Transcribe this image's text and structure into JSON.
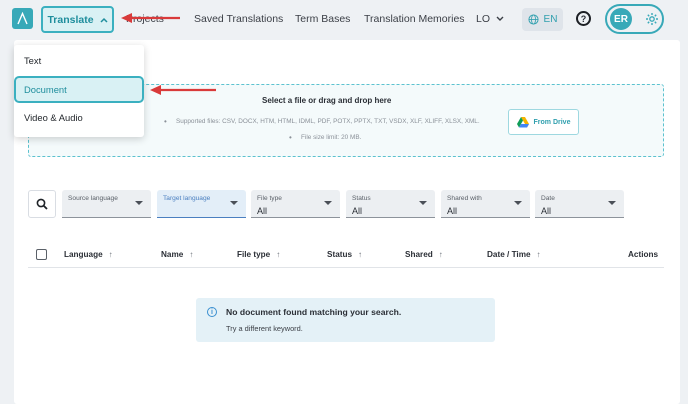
{
  "nav": {
    "translate_label": "Translate",
    "projects_label": "Projects",
    "links": [
      "Saved Translations",
      "Term Bases",
      "Translation Memories"
    ],
    "lo_label": "LO",
    "language": "EN",
    "help": "?",
    "user_initials": "ER"
  },
  "menu": {
    "items": [
      "Text",
      "Document",
      "Video & Audio"
    ],
    "selected": "Document"
  },
  "upload": {
    "title": "Select a file or drag and drop here",
    "supported": "Supported files: CSV, DOCX, HTM, HTML, IDML, PDF, POTX, PPTX, TXT, VSDX, XLF, XLIFF, XLSX, XML.",
    "size_limit": "File size limit: 20 MB.",
    "drive_button": "From Drive"
  },
  "filters": [
    {
      "label": "Source language",
      "value": ""
    },
    {
      "label": "Target language",
      "value": ""
    },
    {
      "label": "File type",
      "value": "All"
    },
    {
      "label": "Status",
      "value": "All"
    },
    {
      "label": "Shared with",
      "value": "All"
    },
    {
      "label": "Date",
      "value": "All"
    }
  ],
  "table": {
    "columns": [
      "Language",
      "Name",
      "File type",
      "Status",
      "Shared",
      "Date / Time",
      "Actions"
    ]
  },
  "empty_state": {
    "title": "No document found matching your search.",
    "subtitle": "Try a different keyword."
  },
  "colors": {
    "accent": "#38a9b8",
    "annotation": "#d93a3a"
  }
}
